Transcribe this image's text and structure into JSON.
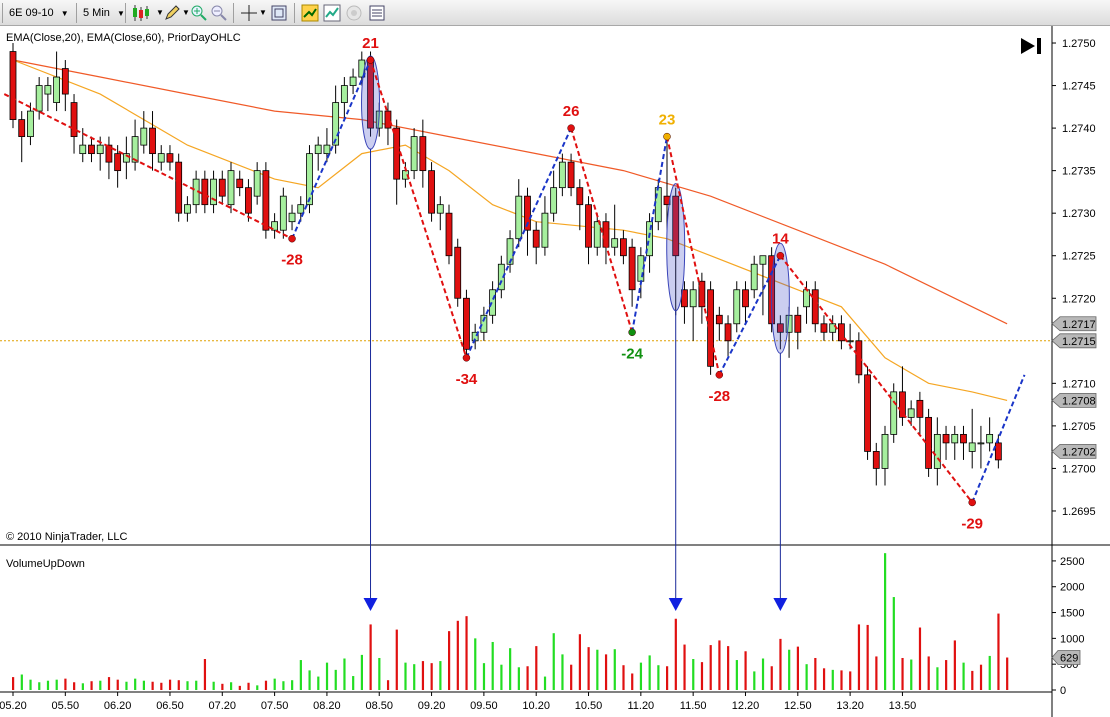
{
  "toolbar": {
    "instrument": "6E 09-10",
    "interval": "5 Min",
    "icons": [
      "candlestick-icon",
      "pencil-icon",
      "zoom-in-icon",
      "zoom-out-icon",
      "crosshair-icon",
      "properties-icon",
      "strategy-icon",
      "chart-trader-icon",
      "disabled-icon",
      "data-box-icon"
    ]
  },
  "price_panel": {
    "indicators_label": "EMA(Close,20), EMA(Close,60), PriorDayOHLC",
    "copyright": "© 2010 NinjaTrader, LLC"
  },
  "volume_panel": {
    "title": "VolumeUpDown"
  },
  "colors": {
    "up": "#a6ef9e",
    "down": "#e01010",
    "ema20": "#f5a623",
    "ema60": "#f05a28",
    "prior_day": "#e0a000",
    "wave_up": "#1a35c8",
    "wave_down": "#e01010",
    "vol_up": "#22dd22",
    "vol_down": "#e01010",
    "arrow": "#1020e0"
  },
  "chart_data": [
    {
      "type": "candlestick",
      "title": "",
      "xlabel": "",
      "ylabel": "",
      "ylim": [
        1.2691,
        1.2752
      ],
      "yticks": [
        "1.2695",
        "1.2700",
        "1.2705",
        "1.2710",
        "1.2715",
        "1.2720",
        "1.2725",
        "1.2730",
        "1.2735",
        "1.2740",
        "1.2745",
        "1.2750"
      ],
      "xticks": [
        "05.20",
        "05.50",
        "06.20",
        "06.50",
        "07.20",
        "07.50",
        "08.20",
        "08.50",
        "09.20",
        "09.50",
        "10.20",
        "10.50",
        "11.20",
        "11.50",
        "12.20",
        "12.50",
        "13.20",
        "13.50"
      ],
      "grid": false,
      "candles": [
        [
          1.2749,
          1.2741,
          1.275,
          1.274
        ],
        [
          1.2741,
          1.2739,
          1.2742,
          1.2736
        ],
        [
          1.2739,
          1.2742,
          1.2743,
          1.2738
        ],
        [
          1.2742,
          1.2745,
          1.2746,
          1.2741
        ],
        [
          1.2744,
          1.2745,
          1.2746,
          1.2742
        ],
        [
          1.2743,
          1.2746,
          1.2749,
          1.2742
        ],
        [
          1.2747,
          1.2744,
          1.2748,
          1.2742
        ],
        [
          1.2743,
          1.2739,
          1.2744,
          1.2737
        ],
        [
          1.2737,
          1.2738,
          1.274,
          1.2736
        ],
        [
          1.2738,
          1.2737,
          1.2739,
          1.2736
        ],
        [
          1.2737,
          1.2738,
          1.2739,
          1.2735
        ],
        [
          1.2738,
          1.2736,
          1.2739,
          1.2734
        ],
        [
          1.2737,
          1.2735,
          1.2738,
          1.2733
        ],
        [
          1.2736,
          1.2737,
          1.2739,
          1.2734
        ],
        [
          1.2736,
          1.2739,
          1.2741,
          1.2735
        ],
        [
          1.2738,
          1.274,
          1.2742,
          1.2737
        ],
        [
          1.274,
          1.2737,
          1.2742,
          1.2735
        ],
        [
          1.2736,
          1.2737,
          1.2738,
          1.2735
        ],
        [
          1.2737,
          1.2736,
          1.2738,
          1.2735
        ],
        [
          1.2736,
          1.273,
          1.2737,
          1.2729
        ],
        [
          1.273,
          1.2731,
          1.2732,
          1.2729
        ],
        [
          1.2731,
          1.2734,
          1.2735,
          1.273
        ],
        [
          1.2734,
          1.2731,
          1.2735,
          1.273
        ],
        [
          1.2731,
          1.2734,
          1.2735,
          1.273
        ],
        [
          1.2734,
          1.2732,
          1.2735,
          1.2731
        ],
        [
          1.2731,
          1.2735,
          1.2736,
          1.273
        ],
        [
          1.2734,
          1.2733,
          1.2735,
          1.2732
        ],
        [
          1.2733,
          1.273,
          1.2734,
          1.2729
        ],
        [
          1.2732,
          1.2735,
          1.2736,
          1.2731
        ],
        [
          1.2735,
          1.2728,
          1.2736,
          1.2727
        ],
        [
          1.2728,
          1.2729,
          1.273,
          1.2727
        ],
        [
          1.2728,
          1.2732,
          1.2733,
          1.2727
        ],
        [
          1.2729,
          1.273,
          1.2731,
          1.2728
        ],
        [
          1.273,
          1.2731,
          1.2732,
          1.2729
        ],
        [
          1.2731,
          1.2737,
          1.2738,
          1.273
        ],
        [
          1.2737,
          1.2738,
          1.2739,
          1.2735
        ],
        [
          1.2737,
          1.2738,
          1.274,
          1.2736
        ],
        [
          1.2738,
          1.2743,
          1.2745,
          1.2737
        ],
        [
          1.2743,
          1.2745,
          1.2746,
          1.2741
        ],
        [
          1.2745,
          1.2746,
          1.2747,
          1.2744
        ],
        [
          1.2746,
          1.2748,
          1.2749,
          1.2745
        ],
        [
          1.2748,
          1.274,
          1.2749,
          1.2739
        ],
        [
          1.274,
          1.2742,
          1.2743,
          1.2739
        ],
        [
          1.2742,
          1.274,
          1.2743,
          1.2738
        ],
        [
          1.274,
          1.2734,
          1.2741,
          1.2731
        ],
        [
          1.2734,
          1.2735,
          1.2736,
          1.2733
        ],
        [
          1.2735,
          1.2739,
          1.274,
          1.2734
        ],
        [
          1.2739,
          1.2735,
          1.2741,
          1.2733
        ],
        [
          1.2735,
          1.273,
          1.2736,
          1.2729
        ],
        [
          1.273,
          1.2731,
          1.2732,
          1.2728
        ],
        [
          1.273,
          1.2725,
          1.2731,
          1.2724
        ],
        [
          1.2726,
          1.272,
          1.2727,
          1.2719
        ],
        [
          1.272,
          1.2714,
          1.2721,
          1.2713
        ],
        [
          1.2715,
          1.2716,
          1.2717,
          1.2714
        ],
        [
          1.2716,
          1.2718,
          1.2719,
          1.2715
        ],
        [
          1.2718,
          1.2721,
          1.2722,
          1.2717
        ],
        [
          1.2721,
          1.2724,
          1.2725,
          1.272
        ],
        [
          1.2724,
          1.2727,
          1.2728,
          1.2723
        ],
        [
          1.2727,
          1.2732,
          1.2734,
          1.2726
        ],
        [
          1.2732,
          1.2728,
          1.2733,
          1.2725
        ],
        [
          1.2728,
          1.2726,
          1.2729,
          1.2724
        ],
        [
          1.2726,
          1.273,
          1.2732,
          1.2725
        ],
        [
          1.273,
          1.2733,
          1.2735,
          1.2729
        ],
        [
          1.2733,
          1.2736,
          1.2737,
          1.2732
        ],
        [
          1.2736,
          1.2733,
          1.2737,
          1.2732
        ],
        [
          1.2733,
          1.2731,
          1.2734,
          1.2728
        ],
        [
          1.2731,
          1.2726,
          1.2732,
          1.2724
        ],
        [
          1.2726,
          1.2729,
          1.273,
          1.2725
        ],
        [
          1.2729,
          1.2726,
          1.273,
          1.2724
        ],
        [
          1.2726,
          1.2727,
          1.2731,
          1.2725
        ],
        [
          1.2727,
          1.2725,
          1.2728,
          1.2724
        ],
        [
          1.2726,
          1.2721,
          1.2727,
          1.2719
        ],
        [
          1.2722,
          1.2725,
          1.2726,
          1.272
        ],
        [
          1.2725,
          1.2729,
          1.273,
          1.2723
        ],
        [
          1.2729,
          1.2733,
          1.2734,
          1.2728
        ],
        [
          1.2732,
          1.2731,
          1.2739,
          1.2728
        ],
        [
          1.2732,
          1.2725,
          1.2733,
          1.2718
        ],
        [
          1.2721,
          1.2719,
          1.2722,
          1.2717
        ],
        [
          1.2719,
          1.2721,
          1.2722,
          1.2715
        ],
        [
          1.2722,
          1.2719,
          1.2723,
          1.2717
        ],
        [
          1.2721,
          1.2712,
          1.2722,
          1.2711
        ],
        [
          1.2718,
          1.2717,
          1.2719,
          1.2715
        ],
        [
          1.2717,
          1.2715,
          1.2718,
          1.2713
        ],
        [
          1.2717,
          1.2721,
          1.2722,
          1.2716
        ],
        [
          1.2721,
          1.2719,
          1.2722,
          1.2717
        ],
        [
          1.2721,
          1.2724,
          1.2725,
          1.272
        ],
        [
          1.2724,
          1.2725,
          1.2725,
          1.2718
        ],
        [
          1.2725,
          1.2717,
          1.2726,
          1.2716
        ],
        [
          1.2717,
          1.2716,
          1.2718,
          1.2714
        ],
        [
          1.2716,
          1.2718,
          1.2719,
          1.2713
        ],
        [
          1.2718,
          1.2716,
          1.2719,
          1.2714
        ],
        [
          1.2719,
          1.2721,
          1.2722,
          1.2717
        ],
        [
          1.2721,
          1.2717,
          1.2722,
          1.2716
        ],
        [
          1.2717,
          1.2716,
          1.2718,
          1.2715
        ],
        [
          1.2716,
          1.2717,
          1.2718,
          1.2715
        ],
        [
          1.2717,
          1.2715,
          1.2718,
          1.2714
        ],
        [
          1.2715,
          1.2715,
          1.2717,
          1.2714
        ],
        [
          1.2715,
          1.2711,
          1.2716,
          1.271
        ],
        [
          1.2711,
          1.2702,
          1.2712,
          1.2701
        ],
        [
          1.2702,
          1.27,
          1.2703,
          1.2698
        ],
        [
          1.27,
          1.2704,
          1.2705,
          1.2698
        ],
        [
          1.2704,
          1.2709,
          1.271,
          1.2703
        ],
        [
          1.2709,
          1.2706,
          1.2712,
          1.2705
        ],
        [
          1.2706,
          1.2707,
          1.2708,
          1.2705
        ],
        [
          1.2708,
          1.2706,
          1.2709,
          1.2704
        ],
        [
          1.2706,
          1.27,
          1.2707,
          1.2699
        ],
        [
          1.27,
          1.2704,
          1.2706,
          1.2698
        ],
        [
          1.2704,
          1.2703,
          1.2705,
          1.2701
        ],
        [
          1.2703,
          1.2704,
          1.2705,
          1.2701
        ],
        [
          1.2704,
          1.2703,
          1.2705,
          1.2701
        ],
        [
          1.2702,
          1.2703,
          1.2707,
          1.27
        ],
        [
          1.2703,
          1.2703,
          1.2705,
          1.27
        ],
        [
          1.2703,
          1.2704,
          1.2706,
          1.2702
        ],
        [
          1.2703,
          1.2701,
          1.2704,
          1.27
        ]
      ],
      "ema20_points": [
        [
          0,
          1.2748
        ],
        [
          10,
          1.2744
        ],
        [
          20,
          1.2738
        ],
        [
          30,
          1.2734
        ],
        [
          35,
          1.2733
        ],
        [
          40,
          1.2737
        ],
        [
          45,
          1.2738
        ],
        [
          50,
          1.2735
        ],
        [
          55,
          1.2731
        ],
        [
          60,
          1.2729
        ],
        [
          70,
          1.2728
        ],
        [
          75,
          1.2727
        ],
        [
          80,
          1.2725
        ],
        [
          90,
          1.2721
        ],
        [
          95,
          1.2719
        ],
        [
          100,
          1.2713
        ],
        [
          105,
          1.271
        ],
        [
          110,
          1.2709
        ],
        [
          114,
          1.2708
        ]
      ],
      "ema60_points": [
        [
          0,
          1.2748
        ],
        [
          10,
          1.2746
        ],
        [
          20,
          1.2744
        ],
        [
          30,
          1.2742
        ],
        [
          40,
          1.2741
        ],
        [
          50,
          1.2739
        ],
        [
          60,
          1.2737
        ],
        [
          70,
          1.2735
        ],
        [
          80,
          1.2732
        ],
        [
          90,
          1.2728
        ],
        [
          100,
          1.2724
        ],
        [
          110,
          1.2719
        ],
        [
          114,
          1.2717
        ]
      ],
      "prior_day_level": 1.2715,
      "price_markers": [
        {
          "label": "1.2717",
          "value": 1.2717
        },
        {
          "label": "1.2715",
          "value": 1.2715
        },
        {
          "label": "1.2708",
          "value": 1.2708
        },
        {
          "label": "1.2702",
          "value": 1.2702
        }
      ],
      "swings": [
        {
          "bar": -1,
          "price": 1.2744,
          "label": ""
        },
        {
          "bar": 32,
          "price": 1.2727,
          "label": "-28"
        },
        {
          "bar": 41,
          "price": 1.2748,
          "label": "21"
        },
        {
          "bar": 52,
          "price": 1.2713,
          "label": "-34"
        },
        {
          "bar": 64,
          "price": 1.274,
          "label": "26"
        },
        {
          "bar": 71,
          "price": 1.2716,
          "label": "-24"
        },
        {
          "bar": 75,
          "price": 1.2739,
          "label": "23"
        },
        {
          "bar": 81,
          "price": 1.2711,
          "label": "-28"
        },
        {
          "bar": 88,
          "price": 1.2725,
          "label": "14"
        },
        {
          "bar": 110,
          "price": 1.2696,
          "label": "-29"
        },
        {
          "bar": 116,
          "price": 1.2711,
          "label": ""
        }
      ],
      "highlight_ellipses": [
        {
          "bar": 41,
          "top": 1.2748,
          "bottom": 1.2738
        },
        {
          "bar": 76,
          "top": 1.2733,
          "bottom": 1.2719
        },
        {
          "bar": 88,
          "top": 1.2726,
          "bottom": 1.2714
        }
      ]
    },
    {
      "type": "bar",
      "title": "VolumeUpDown",
      "ylim": [
        0,
        2750
      ],
      "yticks": [
        "0",
        "500",
        "1000",
        "1500",
        "2000",
        "2500"
      ],
      "last_value_label": "629",
      "last_value": 629,
      "arrow_bars": [
        41,
        76,
        88
      ],
      "values": [
        250,
        300,
        200,
        150,
        180,
        200,
        220,
        150,
        130,
        170,
        180,
        250,
        200,
        160,
        220,
        180,
        160,
        140,
        200,
        190,
        170,
        180,
        600,
        160,
        120,
        150,
        80,
        140,
        90,
        180,
        220,
        170,
        190,
        580,
        380,
        260,
        530,
        390,
        610,
        270,
        680,
        1270,
        620,
        190,
        1170,
        530,
        500,
        560,
        520,
        560,
        1140,
        1340,
        1430,
        1000,
        520,
        930,
        490,
        810,
        440,
        460,
        850,
        260,
        1100,
        690,
        490,
        1080,
        830,
        780,
        690,
        790,
        480,
        320,
        530,
        670,
        480,
        460,
        1380,
        880,
        600,
        540,
        870,
        960,
        850,
        580,
        750,
        360,
        610,
        460,
        990,
        780,
        840,
        500,
        620,
        420,
        390,
        380,
        360,
        1270,
        1260,
        650,
        2650,
        1800,
        620,
        590,
        1210,
        650,
        440,
        580,
        960,
        530,
        370,
        490,
        660,
        1480,
        629
      ],
      "up": [
        false,
        true,
        true,
        true,
        true,
        true,
        false,
        false,
        true,
        false,
        true,
        false,
        false,
        true,
        true,
        true,
        false,
        false,
        false,
        false,
        true,
        true,
        false,
        true,
        false,
        true,
        false,
        false,
        true,
        false,
        true,
        true,
        true,
        true,
        true,
        true,
        true,
        true,
        true,
        true,
        true,
        false,
        true,
        false,
        false,
        true,
        true,
        false,
        false,
        true,
        false,
        false,
        false,
        true,
        true,
        true,
        true,
        true,
        true,
        false,
        false,
        true,
        true,
        true,
        false,
        false,
        false,
        true,
        false,
        true,
        false,
        false,
        true,
        true,
        true,
        false,
        false,
        false,
        true,
        false,
        false,
        false,
        false,
        true,
        false,
        true,
        true,
        false,
        false,
        true,
        false,
        true,
        false,
        false,
        true,
        false,
        false,
        false,
        false,
        false,
        true,
        true,
        false,
        true,
        false,
        false,
        true,
        false,
        false,
        true,
        false,
        false,
        true,
        false
      ]
    }
  ]
}
